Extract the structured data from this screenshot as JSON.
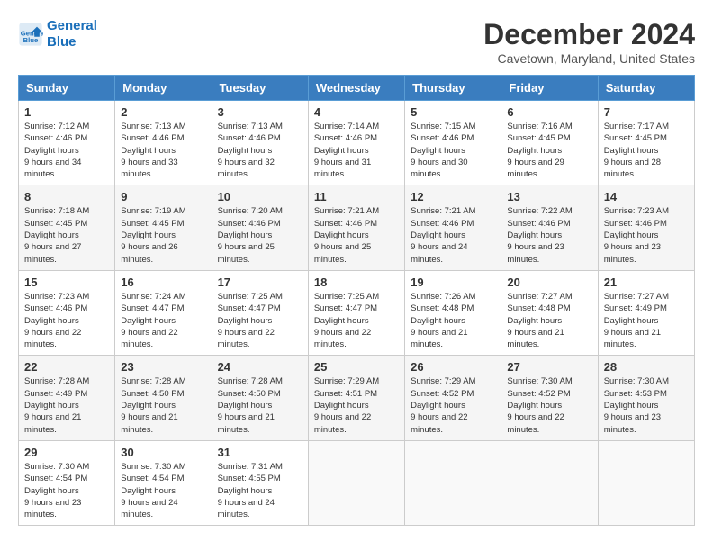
{
  "logo": {
    "line1": "General",
    "line2": "Blue"
  },
  "title": "December 2024",
  "location": "Cavetown, Maryland, United States",
  "days_of_week": [
    "Sunday",
    "Monday",
    "Tuesday",
    "Wednesday",
    "Thursday",
    "Friday",
    "Saturday"
  ],
  "weeks": [
    [
      {
        "day": "1",
        "sunrise": "7:12 AM",
        "sunset": "4:46 PM",
        "daylight": "9 hours and 34 minutes."
      },
      {
        "day": "2",
        "sunrise": "7:13 AM",
        "sunset": "4:46 PM",
        "daylight": "9 hours and 33 minutes."
      },
      {
        "day": "3",
        "sunrise": "7:13 AM",
        "sunset": "4:46 PM",
        "daylight": "9 hours and 32 minutes."
      },
      {
        "day": "4",
        "sunrise": "7:14 AM",
        "sunset": "4:46 PM",
        "daylight": "9 hours and 31 minutes."
      },
      {
        "day": "5",
        "sunrise": "7:15 AM",
        "sunset": "4:46 PM",
        "daylight": "9 hours and 30 minutes."
      },
      {
        "day": "6",
        "sunrise": "7:16 AM",
        "sunset": "4:45 PM",
        "daylight": "9 hours and 29 minutes."
      },
      {
        "day": "7",
        "sunrise": "7:17 AM",
        "sunset": "4:45 PM",
        "daylight": "9 hours and 28 minutes."
      }
    ],
    [
      {
        "day": "8",
        "sunrise": "7:18 AM",
        "sunset": "4:45 PM",
        "daylight": "9 hours and 27 minutes."
      },
      {
        "day": "9",
        "sunrise": "7:19 AM",
        "sunset": "4:45 PM",
        "daylight": "9 hours and 26 minutes."
      },
      {
        "day": "10",
        "sunrise": "7:20 AM",
        "sunset": "4:46 PM",
        "daylight": "9 hours and 25 minutes."
      },
      {
        "day": "11",
        "sunrise": "7:21 AM",
        "sunset": "4:46 PM",
        "daylight": "9 hours and 25 minutes."
      },
      {
        "day": "12",
        "sunrise": "7:21 AM",
        "sunset": "4:46 PM",
        "daylight": "9 hours and 24 minutes."
      },
      {
        "day": "13",
        "sunrise": "7:22 AM",
        "sunset": "4:46 PM",
        "daylight": "9 hours and 23 minutes."
      },
      {
        "day": "14",
        "sunrise": "7:23 AM",
        "sunset": "4:46 PM",
        "daylight": "9 hours and 23 minutes."
      }
    ],
    [
      {
        "day": "15",
        "sunrise": "7:23 AM",
        "sunset": "4:46 PM",
        "daylight": "9 hours and 22 minutes."
      },
      {
        "day": "16",
        "sunrise": "7:24 AM",
        "sunset": "4:47 PM",
        "daylight": "9 hours and 22 minutes."
      },
      {
        "day": "17",
        "sunrise": "7:25 AM",
        "sunset": "4:47 PM",
        "daylight": "9 hours and 22 minutes."
      },
      {
        "day": "18",
        "sunrise": "7:25 AM",
        "sunset": "4:47 PM",
        "daylight": "9 hours and 22 minutes."
      },
      {
        "day": "19",
        "sunrise": "7:26 AM",
        "sunset": "4:48 PM",
        "daylight": "9 hours and 21 minutes."
      },
      {
        "day": "20",
        "sunrise": "7:27 AM",
        "sunset": "4:48 PM",
        "daylight": "9 hours and 21 minutes."
      },
      {
        "day": "21",
        "sunrise": "7:27 AM",
        "sunset": "4:49 PM",
        "daylight": "9 hours and 21 minutes."
      }
    ],
    [
      {
        "day": "22",
        "sunrise": "7:28 AM",
        "sunset": "4:49 PM",
        "daylight": "9 hours and 21 minutes."
      },
      {
        "day": "23",
        "sunrise": "7:28 AM",
        "sunset": "4:50 PM",
        "daylight": "9 hours and 21 minutes."
      },
      {
        "day": "24",
        "sunrise": "7:28 AM",
        "sunset": "4:50 PM",
        "daylight": "9 hours and 21 minutes."
      },
      {
        "day": "25",
        "sunrise": "7:29 AM",
        "sunset": "4:51 PM",
        "daylight": "9 hours and 22 minutes."
      },
      {
        "day": "26",
        "sunrise": "7:29 AM",
        "sunset": "4:52 PM",
        "daylight": "9 hours and 22 minutes."
      },
      {
        "day": "27",
        "sunrise": "7:30 AM",
        "sunset": "4:52 PM",
        "daylight": "9 hours and 22 minutes."
      },
      {
        "day": "28",
        "sunrise": "7:30 AM",
        "sunset": "4:53 PM",
        "daylight": "9 hours and 23 minutes."
      }
    ],
    [
      {
        "day": "29",
        "sunrise": "7:30 AM",
        "sunset": "4:54 PM",
        "daylight": "9 hours and 23 minutes."
      },
      {
        "day": "30",
        "sunrise": "7:30 AM",
        "sunset": "4:54 PM",
        "daylight": "9 hours and 24 minutes."
      },
      {
        "day": "31",
        "sunrise": "7:31 AM",
        "sunset": "4:55 PM",
        "daylight": "9 hours and 24 minutes."
      },
      null,
      null,
      null,
      null
    ]
  ]
}
